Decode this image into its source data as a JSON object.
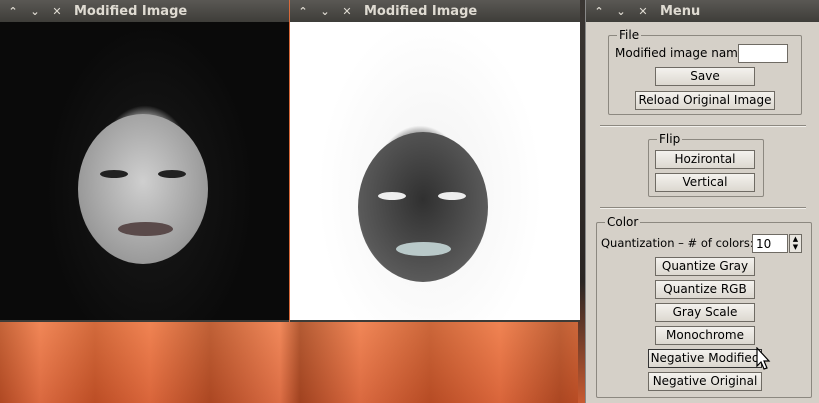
{
  "windows": {
    "left": {
      "title": "Modified Image"
    },
    "right": {
      "title": "Modified Image"
    },
    "menu": {
      "title": "Menu"
    }
  },
  "titlebar_buttons": {
    "minimize": "⌃",
    "maximize": "⌄",
    "close": "✕"
  },
  "file": {
    "label": "File",
    "name_label": "Modified image name:",
    "name_value": "",
    "save": "Save",
    "reload": "Reload Original Image"
  },
  "flip": {
    "label": "Flip",
    "horizontal": "Hozirontal",
    "vertical": "Vertical"
  },
  "color": {
    "label": "Color",
    "quant_label": "Quantization – # of colors:",
    "quant_value": "10",
    "quantize_gray": "Quantize Gray",
    "quantize_rgb": "Quantize RGB",
    "gray_scale": "Gray Scale",
    "monochrome": "Monochrome",
    "negative_modified": "Negative Modified",
    "negative_original": "Negative Original"
  }
}
